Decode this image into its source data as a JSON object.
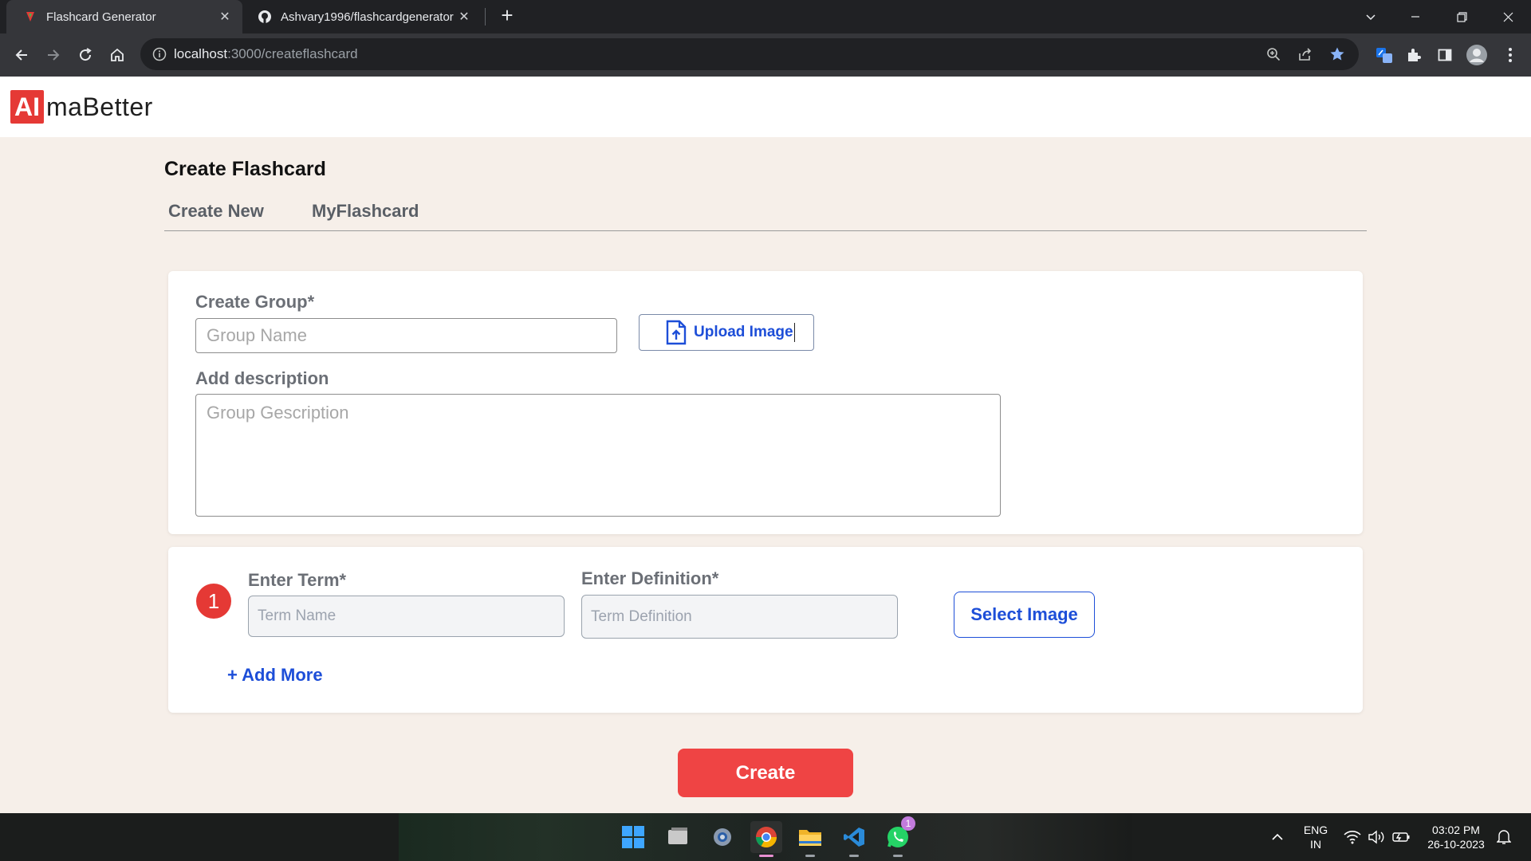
{
  "browser": {
    "tabs": [
      {
        "title": "Flashcard Generator",
        "active": true,
        "icon": "flashcard-favicon"
      },
      {
        "title": "Ashvary1996/flashcardgenerator",
        "active": false,
        "icon": "github-icon"
      }
    ],
    "url_host": "localhost",
    "url_path": ":3000/createflashcard"
  },
  "app": {
    "logo_mark": "AI",
    "logo_text": "maBetter",
    "page_title": "Create Flashcard",
    "nav_tabs": [
      "Create New",
      "MyFlashcard"
    ],
    "group": {
      "create_label": "Create Group*",
      "name_placeholder": "Group Name",
      "upload_label": "Upload Image",
      "description_label": "Add description",
      "description_placeholder": "Group Gescription"
    },
    "term": {
      "number": "1",
      "term_label": "Enter Term*",
      "term_placeholder": "Term Name",
      "definition_label": "Enter Definition*",
      "definition_placeholder": "Term Definition",
      "select_image_label": "Select Image",
      "add_more_label": "+ Add More"
    },
    "create_button": "Create"
  },
  "taskbar": {
    "whatsapp_badge": "1",
    "language_line1": "ENG",
    "language_line2": "IN",
    "time": "03:02 PM",
    "date": "26-10-2023"
  },
  "colors": {
    "accent_red": "#ef4444",
    "link_blue": "#1d4ed8",
    "page_bg": "#f6efe9"
  }
}
